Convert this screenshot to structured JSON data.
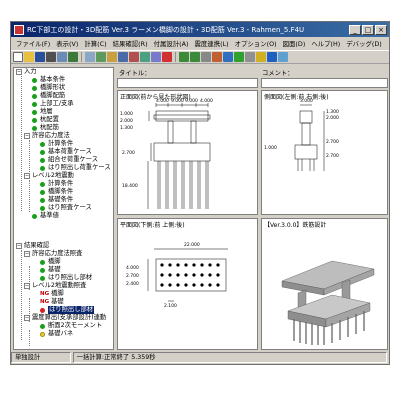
{
  "window": {
    "title": "RC下部工の設計・3D配筋 Ver.3 ラーメン橋脚の設計・3D配筋 Ver.3 - Rahmen_5.F4U"
  },
  "menu": [
    "ファイル(F)",
    "表示(V)",
    "計算(C)",
    "結果確認(R)",
    "付属設計(A)",
    "震度連携(L)",
    "オプション(O)",
    "図面(D)",
    "ヘルプ(H)",
    "デバッグ(D)"
  ],
  "toolbar": {
    "icons": [
      "new-icon",
      "open-icon",
      "save-icon",
      "print-icon",
      "preview-icon",
      "export-icon",
      "view-icon",
      "grid-icon",
      "table-icon",
      "calc-icon",
      "chart-icon",
      "result-icon",
      "rebar-icon",
      "stop-icon",
      "undo-icon",
      "redo-icon",
      "dimension-icon",
      "shape-icon",
      "draw-icon",
      "check-icon",
      "options-icon",
      "key-icon",
      "help-icon",
      "info-icon"
    ]
  },
  "fields": {
    "title_label": "タイトル：",
    "comment_label": "コメント："
  },
  "tree": [
    {
      "label": "入力",
      "level": 0,
      "kind": "folder"
    },
    {
      "label": "基本条件",
      "level": 1,
      "kind": "green"
    },
    {
      "label": "橋脚形状",
      "level": 1,
      "kind": "green"
    },
    {
      "label": "橋脚配筋",
      "level": 1,
      "kind": "green"
    },
    {
      "label": "上部工/支承",
      "level": 1,
      "kind": "green"
    },
    {
      "label": "地層",
      "level": 1,
      "kind": "green"
    },
    {
      "label": "杭配置",
      "level": 1,
      "kind": "green"
    },
    {
      "label": "杭配筋",
      "level": 1,
      "kind": "green"
    },
    {
      "label": "許容応力度法",
      "level": 1,
      "kind": "folder"
    },
    {
      "label": "計算条件",
      "level": 2,
      "kind": "green"
    },
    {
      "label": "基本荷重ケース",
      "level": 2,
      "kind": "green"
    },
    {
      "label": "組合せ荷重ケース",
      "level": 2,
      "kind": "green"
    },
    {
      "label": "はり照出し荷重ケース",
      "level": 2,
      "kind": "green"
    },
    {
      "label": "レベル2地震動",
      "level": 1,
      "kind": "folder"
    },
    {
      "label": "計算条件",
      "level": 2,
      "kind": "green"
    },
    {
      "label": "橋脚条件",
      "level": 2,
      "kind": "green"
    },
    {
      "label": "基礎条件",
      "level": 2,
      "kind": "green"
    },
    {
      "label": "はり照査ケース",
      "level": 2,
      "kind": "green"
    },
    {
      "label": "基準値",
      "level": 1,
      "kind": "green"
    },
    {
      "label": "結果確認",
      "level": 0,
      "kind": "folder"
    },
    {
      "label": "許容応力度法照査",
      "level": 1,
      "kind": "folder"
    },
    {
      "label": "橋脚",
      "level": 2,
      "kind": "green"
    },
    {
      "label": "基礎",
      "level": 2,
      "kind": "green"
    },
    {
      "label": "はり照出し部材",
      "level": 2,
      "kind": "green"
    },
    {
      "label": "レベル2地震動照査",
      "level": 1,
      "kind": "folder"
    },
    {
      "label": "橋脚",
      "level": 2,
      "kind": "ng",
      "mark": "NG"
    },
    {
      "label": "基礎",
      "level": 2,
      "kind": "ng",
      "mark": "NG"
    },
    {
      "label": "はり照出し部材",
      "level": 2,
      "kind": "selected"
    },
    {
      "label": "震度算出(支承部設計)連動",
      "level": 1,
      "kind": "folder"
    },
    {
      "label": "断面2次モーメント",
      "level": 2,
      "kind": "green"
    },
    {
      "label": "基礎バネ",
      "level": 2,
      "kind": "yellow"
    }
  ],
  "panels": {
    "front": {
      "title": "正面図(前から見た形状図)",
      "dims_top": [
        "4.000",
        "9.000",
        "9.000",
        "4.000"
      ],
      "dims_left": [
        "1.000",
        "2.000",
        "1.300"
      ],
      "dims_side": [
        "2.700",
        "18.400"
      ]
    },
    "side": {
      "title": "側面図(左側:前 右側:後)",
      "dims_top": [
        "3.000"
      ],
      "dims_side": [
        "1.300",
        "2.000",
        "2.700",
        "1.000",
        "2.700"
      ]
    },
    "plan": {
      "title": "平面図(下側:前 上側:後)",
      "dims_top": [
        "22.000"
      ],
      "dims_left": [
        "4.000",
        "2.700",
        "2.400"
      ],
      "dims_bottom": [
        "2.100"
      ]
    },
    "view3d": {
      "title": "【Ver.3.0.0】鉄筋設計"
    }
  },
  "status": [
    "単独設計",
    "一括計算:正常終了 5.359秒"
  ]
}
